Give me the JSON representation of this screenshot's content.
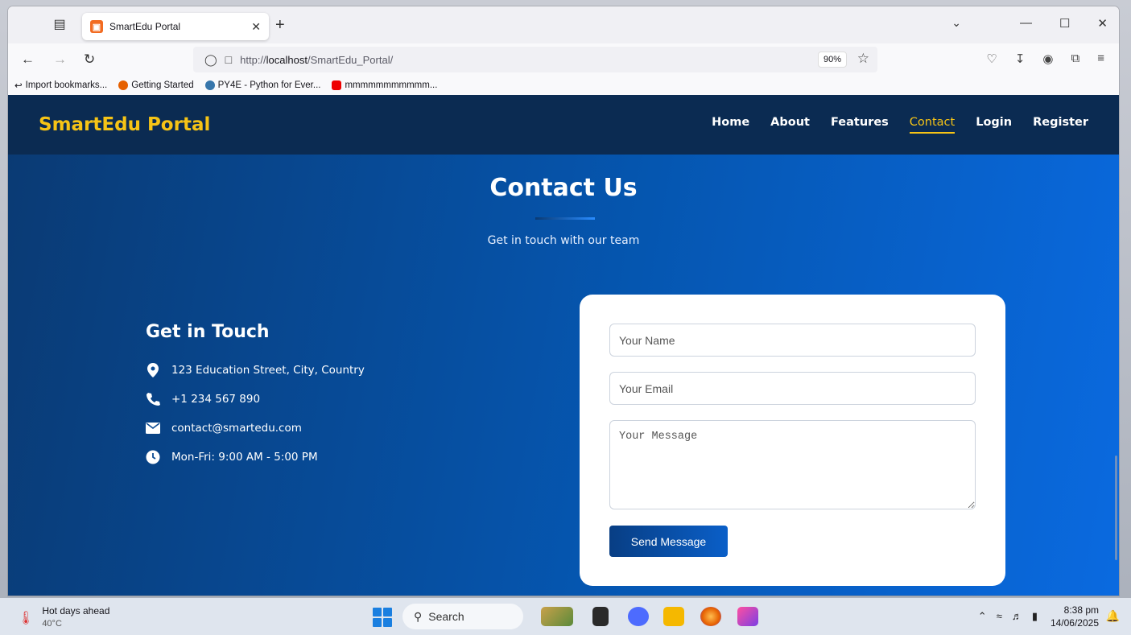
{
  "browser": {
    "tab_title": "SmartEdu Portal",
    "url_prefix": "http://",
    "url_host": "localhost",
    "url_path": "/SmartEdu_Portal/",
    "zoom": "90%",
    "bookmarks": [
      "Import bookmarks...",
      "Getting Started",
      "PY4E - Python for Ever...",
      "mmmmmmmmmmm..."
    ]
  },
  "site": {
    "brand": "SmartEdu Portal",
    "nav": [
      "Home",
      "About",
      "Features",
      "Contact",
      "Login",
      "Register"
    ],
    "active_nav": "Contact"
  },
  "hero": {
    "title": "Contact Us",
    "subtitle": "Get in touch with our team"
  },
  "contact_info": {
    "title": "Get in Touch",
    "address": "123 Education Street, City, Country",
    "phone": "+1 234 567 890",
    "email": "contact@smartedu.com",
    "hours": "Mon-Fri: 9:00 AM - 5:00 PM"
  },
  "form": {
    "name_placeholder": "Your Name",
    "email_placeholder": "Your Email",
    "message_placeholder": "Your Message",
    "submit_label": "Send Message"
  },
  "taskbar": {
    "weather_title": "Hot days ahead",
    "weather_temp": "40°C",
    "search_label": "Search",
    "time": "8:38 pm",
    "date": "14/06/2025"
  },
  "colors": {
    "brand_yellow": "#f6c416",
    "header_navy": "#0b2b52",
    "page_blue": "#0556b0",
    "button_blue": "#083e84"
  }
}
